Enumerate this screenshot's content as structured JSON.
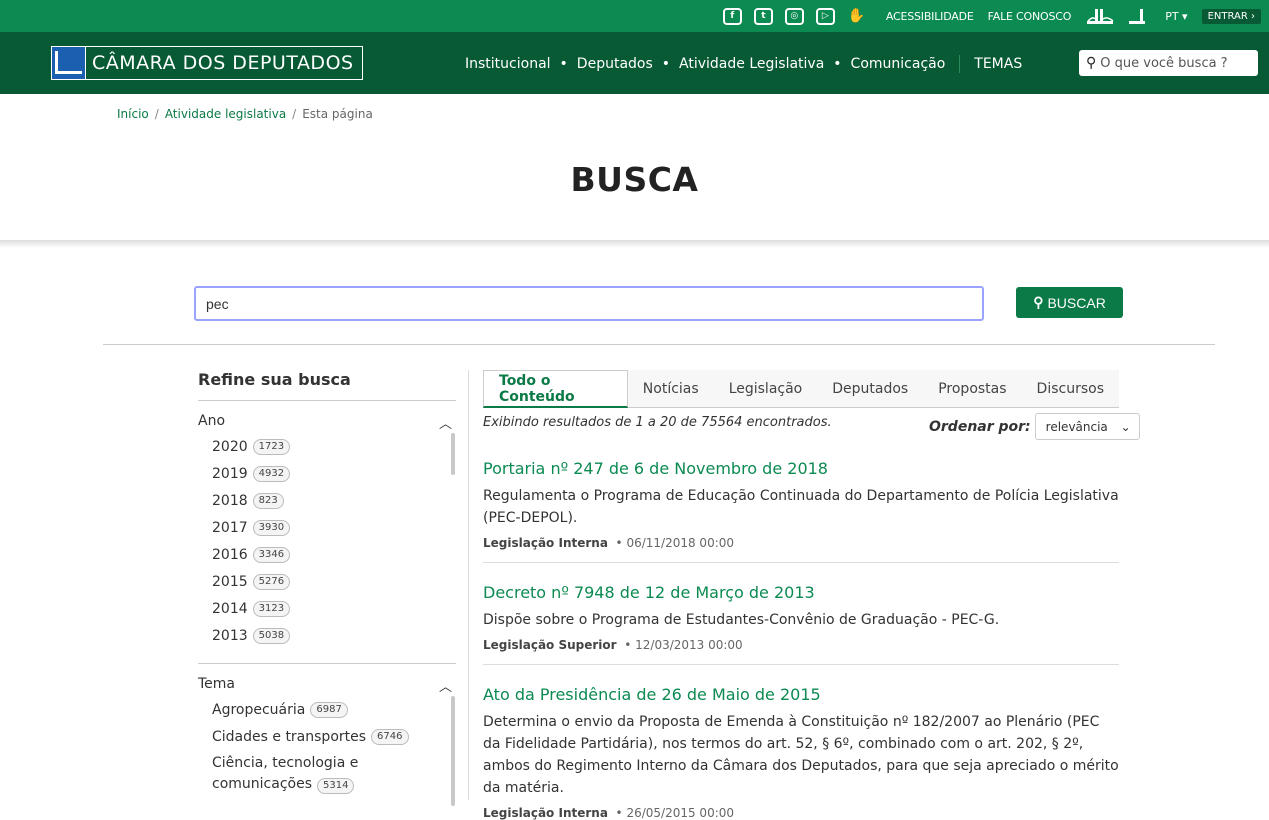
{
  "topbar": {
    "accessibility": "ACESSIBILIDADE",
    "contact": "FALE CONOSCO",
    "lang": "PT ▾",
    "login": "ENTRAR ›"
  },
  "header": {
    "logo_text": "CÂMARA DOS DEPUTADOS",
    "nav": [
      "Institucional",
      "Deputados",
      "Atividade Legislativa",
      "Comunicação"
    ],
    "temas": "TEMAS",
    "search_placeholder": "O que você busca ?"
  },
  "breadcrumb": {
    "home": "Início",
    "section": "Atividade legislativa",
    "current": "Esta página"
  },
  "page_title": "BUSCA",
  "search": {
    "value": "pec",
    "button": "BUSCAR"
  },
  "refine": {
    "title": "Refine sua busca",
    "ano": {
      "label": "Ano",
      "items": [
        {
          "label": "2020",
          "count": "1723"
        },
        {
          "label": "2019",
          "count": "4932"
        },
        {
          "label": "2018",
          "count": "823"
        },
        {
          "label": "2017",
          "count": "3930"
        },
        {
          "label": "2016",
          "count": "3346"
        },
        {
          "label": "2015",
          "count": "5276"
        },
        {
          "label": "2014",
          "count": "3123"
        },
        {
          "label": "2013",
          "count": "5038"
        }
      ]
    },
    "tema": {
      "label": "Tema",
      "items": [
        {
          "label": "Agropecuária",
          "count": "6987"
        },
        {
          "label": "Cidades e transportes",
          "count": "6746"
        },
        {
          "label": "Ciência, tecnologia e comunicações",
          "count": "5314"
        }
      ]
    }
  },
  "tabs": [
    "Todo o Conteúdo",
    "Notícias",
    "Legislação",
    "Deputados",
    "Propostas",
    "Discursos"
  ],
  "results_info": "Exibindo resultados de 1 a 20 de 75564 encontrados.",
  "order": {
    "label": "Ordenar por:",
    "value": "relevância"
  },
  "results": [
    {
      "title": "Portaria nº 247 de 6 de Novembro de 2018",
      "desc": "Regulamenta o Programa de Educação Continuada do Departamento de Polícia Legislativa (PEC-DEPOL).",
      "type": "Legislação Interna",
      "date": "06/11/2018 00:00"
    },
    {
      "title": "Decreto nº 7948 de 12 de Março de 2013",
      "desc": "Dispõe sobre o Programa de Estudantes-Convênio de Graduação - PEC-G.",
      "type": "Legislação Superior",
      "date": "12/03/2013 00:00"
    },
    {
      "title": "Ato da Presidência de 26 de Maio de 2015",
      "desc": "Determina o envio da Proposta de Emenda à Constituição nº 182/2007 ao Plenário (PEC da Fidelidade Partidária), nos termos do art. 52, § 6º, combinado com o art. 202, § 2º, ambos do Regimento Interno da Câmara dos Deputados, para que seja apreciado o mérito da matéria.",
      "type": "Legislação Interna",
      "date": "26/05/2015 00:00"
    }
  ],
  "icons": [
    "facebook-icon",
    "twitter-icon",
    "instagram-icon",
    "youtube-icon",
    "sign-language-icon",
    "camara-icon",
    "search-icon",
    "chevron-up-icon",
    "chevron-down-icon"
  ]
}
